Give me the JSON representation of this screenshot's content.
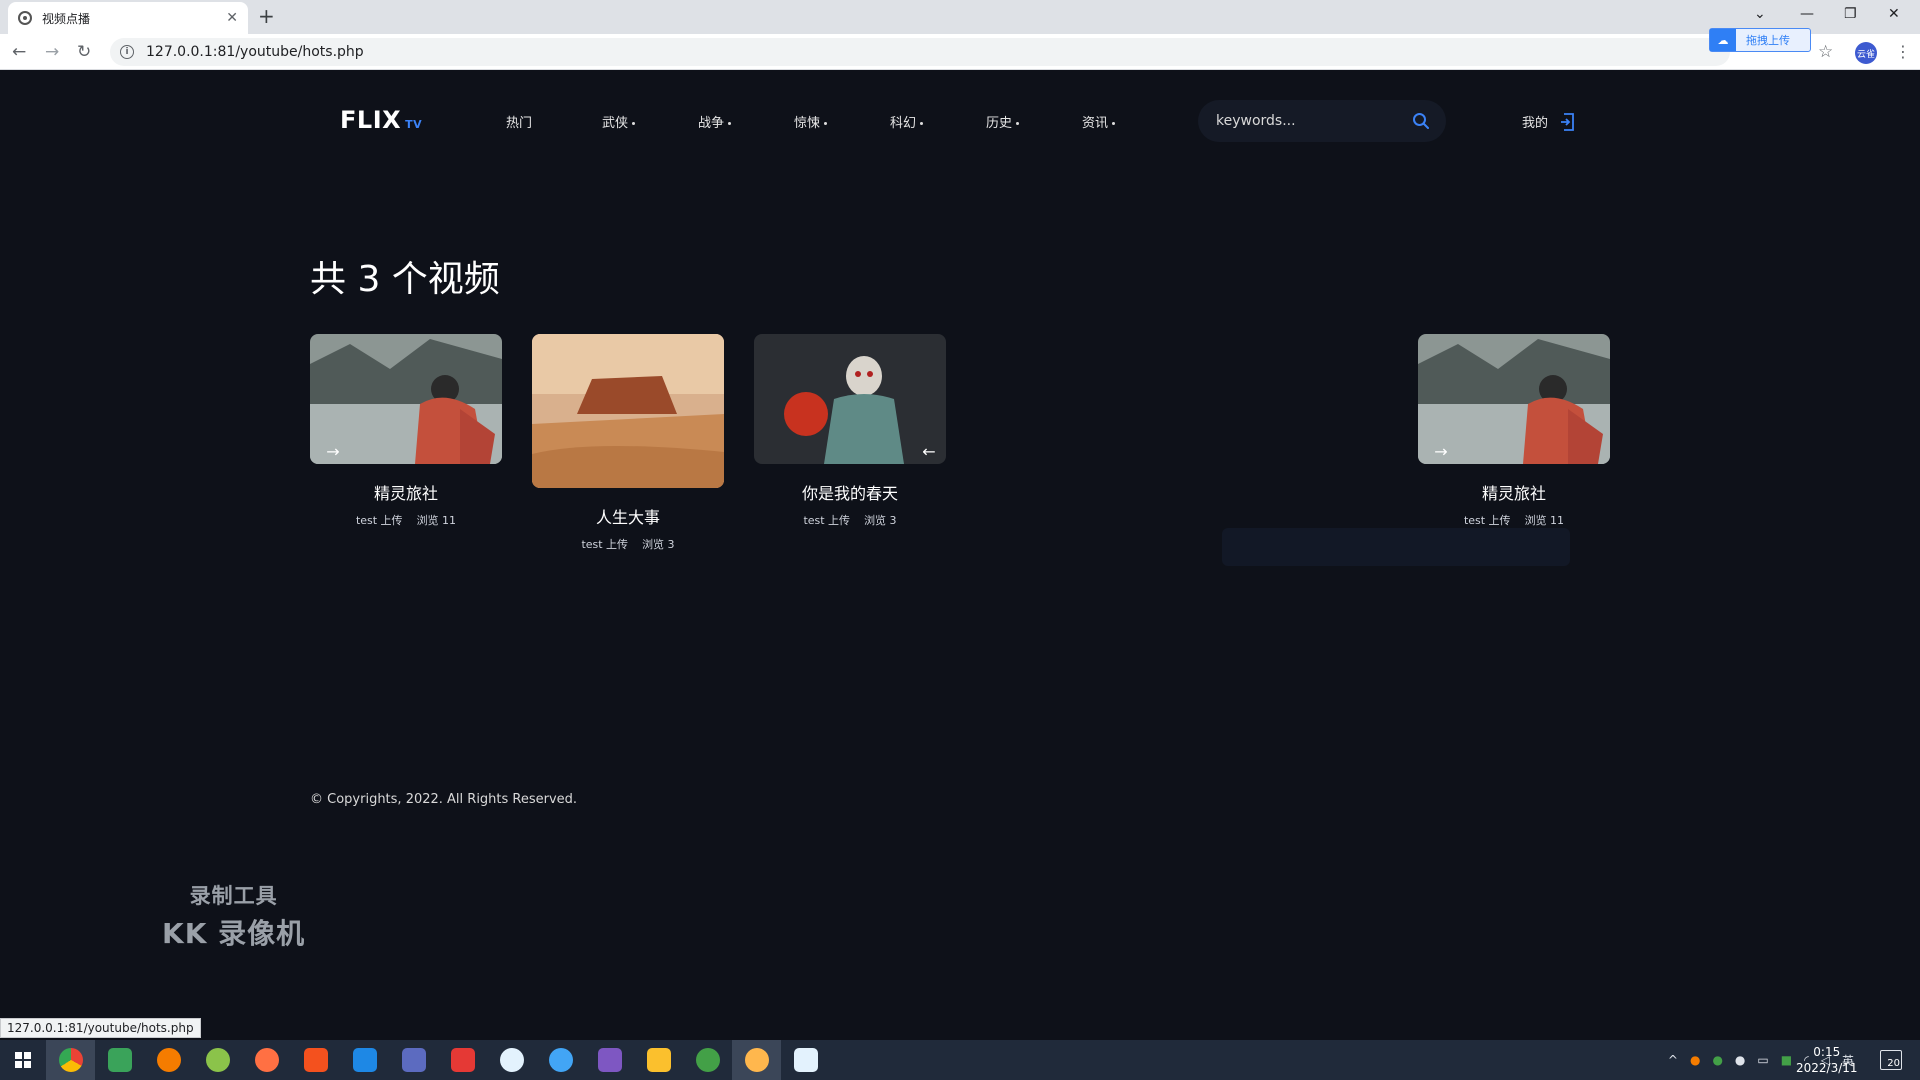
{
  "browser": {
    "tab_title": "视频点播",
    "url": "127.0.0.1:81/youtube/hots.php",
    "upload_label": "拖拽上传",
    "profile_label": "云雀",
    "status_url": "127.0.0.1:81/youtube/hots.php"
  },
  "site": {
    "logo": "FLIX",
    "logo_sub": "TV",
    "nav": [
      {
        "label": "热门"
      },
      {
        "label": "武侠"
      },
      {
        "label": "战争"
      },
      {
        "label": "惊悚"
      },
      {
        "label": "科幻"
      },
      {
        "label": "历史"
      },
      {
        "label": "资讯"
      }
    ],
    "search_placeholder": "keywords...",
    "mine_label": "我的"
  },
  "content": {
    "heading": "共 3 个视频",
    "cards": [
      {
        "title": "精灵旅社",
        "uploader": "test 上传",
        "views": "浏览 11"
      },
      {
        "title": "人生大事",
        "uploader": "test 上传",
        "views": "浏览 3"
      },
      {
        "title": "你是我的春天",
        "uploader": "test 上传",
        "views": "浏览 3"
      },
      {
        "title": "精灵旅社",
        "uploader": "test 上传",
        "views": "浏览 11"
      }
    ]
  },
  "footer": {
    "copyright": "© Copyrights, 2022. All Rights Reserved."
  },
  "watermark": {
    "line1": "录制工具",
    "line2": "KK 录像机"
  },
  "taskbar": {
    "ime": "英",
    "time": "0:15",
    "date": "2022/3/11",
    "notifications": "20"
  },
  "colors": {
    "page_bg": "#0e1119",
    "accent": "#3b82f6"
  }
}
